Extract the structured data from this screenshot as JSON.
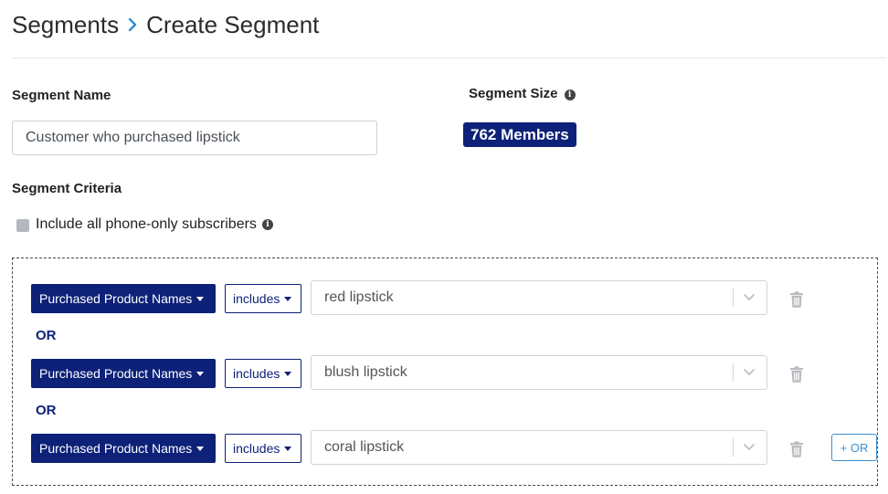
{
  "breadcrumb": {
    "parent": "Segments",
    "current": "Create Segment"
  },
  "segment_name": {
    "label": "Segment Name",
    "value": "Customer who purchased lipstick"
  },
  "segment_size": {
    "label": "Segment Size",
    "badge": "762 Members",
    "badge_color": "#0d2178"
  },
  "criteria": {
    "label": "Segment Criteria",
    "phone_only_label": "Include all phone-only subscribers",
    "phone_only_checked": false,
    "joiner": "OR",
    "rows": [
      {
        "field": "Purchased Product Names",
        "operator": "includes",
        "value": "red lipstick"
      },
      {
        "field": "Purchased Product Names",
        "operator": "includes",
        "value": "blush lipstick"
      },
      {
        "field": "Purchased Product Names",
        "operator": "includes",
        "value": "coral lipstick"
      }
    ],
    "add_or_label": "+ OR"
  },
  "colors": {
    "primary": "#0d2178",
    "accent": "#3c8fcf",
    "icon_gray": "#b8bcc0"
  },
  "icons": [
    "chevron-right-icon",
    "info-icon",
    "caret-down-icon",
    "chevron-down-icon",
    "trash-icon"
  ]
}
